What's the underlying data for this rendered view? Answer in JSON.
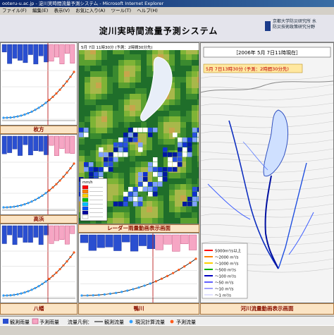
{
  "window": {
    "title": "ooteru-u.ac.jp - 淀川実時間流量予測システム - Microsoft Internet Explorer"
  },
  "menu": [
    "ファイル(F)",
    "編集(E)",
    "表示(V)",
    "お気に入り(A)",
    "ツール(T)",
    "ヘルプ(H)"
  ],
  "header": {
    "title": "淀川実時間流量予測システム",
    "org_line1": "京都大学防災研究所 水",
    "org_line2": "防災技術政策研究分野"
  },
  "stations": [
    {
      "name": "枚方"
    },
    {
      "name": "高浜"
    },
    {
      "name": "八幡"
    },
    {
      "name": "鴨川"
    }
  ],
  "radar": {
    "caption": "5月 7日 11時30分 (予測：2時間30分先)",
    "footer": "レーダー雨量動画表示画面",
    "legend_unit": "mm/h"
  },
  "river": {
    "datetime": "［2006年 5月 7日11時現在］",
    "forecast_caption": "5月 7日13時30分 (予測：2時間30分先)",
    "footer": "河川流量動画表示画面",
    "legend": [
      {
        "label": "5000m³/s以上",
        "color": "#ff0000"
      },
      {
        "label": "〜2000 m³/s",
        "color": "#ff8000"
      },
      {
        "label": "〜1000 m³/s",
        "color": "#ffd000"
      },
      {
        "label": "〜500 m³/s",
        "color": "#00b000"
      },
      {
        "label": "〜100 m³/s",
        "color": "#0000c0"
      },
      {
        "label": "〜50 m³/s",
        "color": "#6060ff"
      },
      {
        "label": "〜10 m³/s",
        "color": "#a0a0ff"
      },
      {
        "label": "〜1 m³/s",
        "color": "#e0e0ff"
      }
    ]
  },
  "legend_bar": {
    "rain_label": "観測雨量",
    "rain_pred_label": "予測雨量",
    "flow_label": "流量凡例：",
    "flow_obs_label": "観測流量",
    "flow_sim_label": "現況計算流量",
    "flow_pred_label": "予測流量"
  },
  "status": {
    "text": ""
  }
}
